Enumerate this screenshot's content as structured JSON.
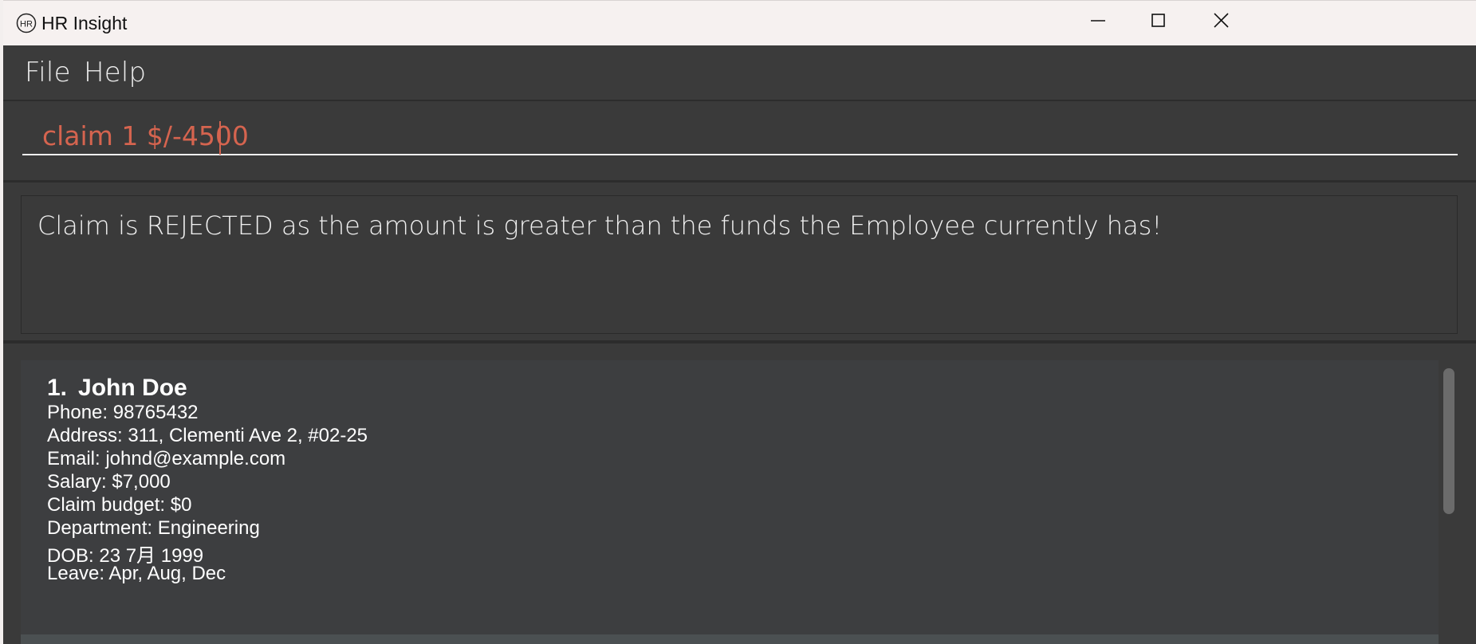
{
  "window": {
    "title": "HR Insight",
    "icon": "hr-logo-icon",
    "controls": [
      "minimize-icon",
      "maximize-icon",
      "close-icon"
    ]
  },
  "menu": {
    "file_label": "File",
    "help_label": "Help"
  },
  "command": {
    "value": "claim 1 $/-4500",
    "text_color": "#d5644f"
  },
  "result": {
    "message": "Claim is REJECTED as the amount is greater than the funds the Employee currently has!"
  },
  "employees": [
    {
      "index": "1.",
      "name": "John Doe",
      "phone": "Phone: 98765432",
      "address": "Address: 311, Clementi Ave 2, #02-25",
      "email": "Email: johnd@example.com",
      "salary": "Salary: $7,000",
      "claim_budget": "Claim budget: $0",
      "department": "Department: Engineering",
      "dob": "DOB: 23 7月 1999",
      "leave": "Leave: Apr, Aug, Dec"
    }
  ],
  "colors": {
    "background": "#3a3a3a",
    "card": "#3d3e40",
    "titlebar": "#f6f1f0",
    "error_text": "#d5644f"
  }
}
